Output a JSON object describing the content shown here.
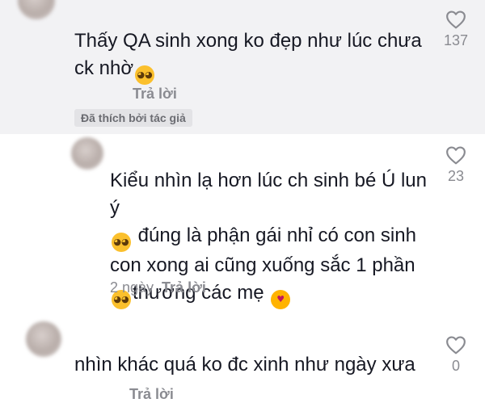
{
  "comments": [
    {
      "text_before": "Thấy QA sinh xong ko đẹp như lúc chưa ck nhờ",
      "emoji_end": "pleading-face",
      "reply_label": "Trả lời",
      "badge": "Đã thích bởi tác giả",
      "likes": "137"
    },
    {
      "line1": "Kiểu nhìn lạ hơn lúc ch sinh bé Ú lun ý",
      "line2": "đúng là phận gái nhỉ có con sinh",
      "line3": "con xong ai cũng xuống sắc 1 phần",
      "line4": "thương các mẹ",
      "date": "2 ngày",
      "reply_label": "Trả lời",
      "likes": "23"
    },
    {
      "text": "nhìn khác quá ko đc xinh như ngày xưa",
      "reply_label": "Trả lời",
      "likes": "0"
    }
  ],
  "colors": {
    "text": "#161823",
    "muted": "#8a8b91",
    "highlight_bg": "#f2f2f4",
    "badge_bg": "#e3e3e6"
  },
  "icons": {
    "like": "heart-outline-icon",
    "emoji1": "pleading-face",
    "emoji2": "smiling-face-with-hearts"
  }
}
